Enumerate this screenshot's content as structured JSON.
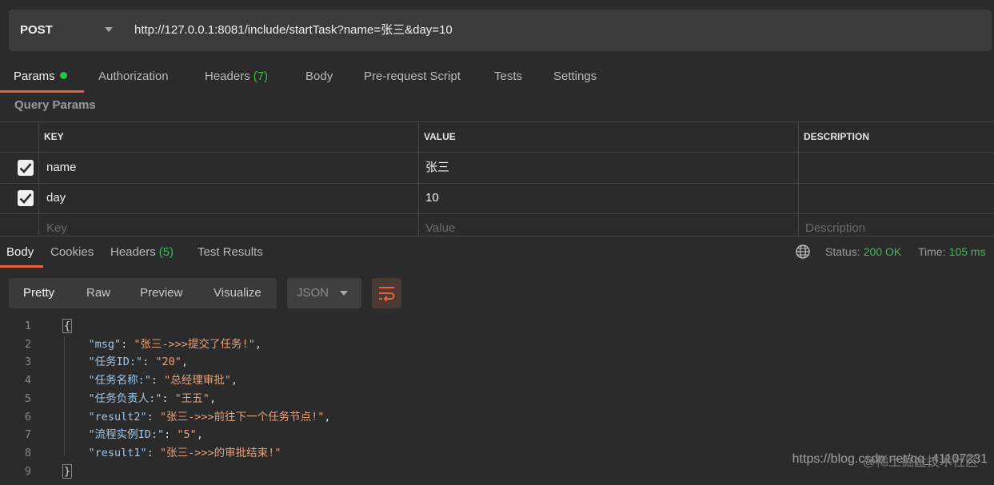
{
  "request": {
    "method": "POST",
    "url": "http://127.0.0.1:8081/include/startTask?name=张三&day=10"
  },
  "request_tabs": [
    {
      "label": "Params",
      "active": true,
      "dot": true
    },
    {
      "label": "Authorization"
    },
    {
      "label": "Headers",
      "count": "(7)"
    },
    {
      "label": "Body"
    },
    {
      "label": "Pre-request Script"
    },
    {
      "label": "Tests"
    },
    {
      "label": "Settings"
    }
  ],
  "params": {
    "section_label": "Query Params",
    "columns": [
      "KEY",
      "VALUE",
      "DESCRIPTION"
    ],
    "rows": [
      {
        "checked": true,
        "key": "name",
        "value": "张三",
        "description": ""
      },
      {
        "checked": true,
        "key": "day",
        "value": "10",
        "description": ""
      }
    ],
    "placeholder": {
      "key": "Key",
      "value": "Value",
      "description": "Description"
    }
  },
  "response_tabs": [
    {
      "label": "Body",
      "active": true
    },
    {
      "label": "Cookies"
    },
    {
      "label": "Headers",
      "count": "(5)"
    },
    {
      "label": "Test Results"
    }
  ],
  "status": {
    "status_label": "Status:",
    "status_value": "200 OK",
    "time_label": "Time:",
    "time_value": "105 ms"
  },
  "view_modes": [
    "Pretty",
    "Raw",
    "Preview",
    "Visualize"
  ],
  "format": "JSON",
  "code_lines": [
    {
      "n": "1",
      "parts": [
        {
          "t": "{",
          "c": "brace"
        }
      ]
    },
    {
      "n": "2",
      "parts": [
        {
          "t": "    ",
          "c": "punct"
        },
        {
          "t": "\"msg\"",
          "c": "key"
        },
        {
          "t": ": ",
          "c": "punct"
        },
        {
          "t": "\"张三->>>提交了任务!\"",
          "c": "str"
        },
        {
          "t": ",",
          "c": "punct"
        }
      ]
    },
    {
      "n": "3",
      "parts": [
        {
          "t": "    ",
          "c": "punct"
        },
        {
          "t": "\"任务ID:\"",
          "c": "key"
        },
        {
          "t": ": ",
          "c": "punct"
        },
        {
          "t": "\"20\"",
          "c": "str"
        },
        {
          "t": ",",
          "c": "punct"
        }
      ]
    },
    {
      "n": "4",
      "parts": [
        {
          "t": "    ",
          "c": "punct"
        },
        {
          "t": "\"任务名称:\"",
          "c": "key"
        },
        {
          "t": ": ",
          "c": "punct"
        },
        {
          "t": "\"总经理审批\"",
          "c": "str"
        },
        {
          "t": ",",
          "c": "punct"
        }
      ]
    },
    {
      "n": "5",
      "parts": [
        {
          "t": "    ",
          "c": "punct"
        },
        {
          "t": "\"任务负责人:\"",
          "c": "key"
        },
        {
          "t": ": ",
          "c": "punct"
        },
        {
          "t": "\"王五\"",
          "c": "str"
        },
        {
          "t": ",",
          "c": "punct"
        }
      ]
    },
    {
      "n": "6",
      "parts": [
        {
          "t": "    ",
          "c": "punct"
        },
        {
          "t": "\"result2\"",
          "c": "key"
        },
        {
          "t": ": ",
          "c": "punct"
        },
        {
          "t": "\"张三->>>前往下一个任务节点!\"",
          "c": "str"
        },
        {
          "t": ",",
          "c": "punct"
        }
      ]
    },
    {
      "n": "7",
      "parts": [
        {
          "t": "    ",
          "c": "punct"
        },
        {
          "t": "\"流程实例ID:\"",
          "c": "key"
        },
        {
          "t": ": ",
          "c": "punct"
        },
        {
          "t": "\"5\"",
          "c": "str"
        },
        {
          "t": ",",
          "c": "punct"
        }
      ]
    },
    {
      "n": "8",
      "parts": [
        {
          "t": "    ",
          "c": "punct"
        },
        {
          "t": "\"result1\"",
          "c": "key"
        },
        {
          "t": ": ",
          "c": "punct"
        },
        {
          "t": "\"张三->>>的审批结束!\"",
          "c": "str"
        }
      ]
    },
    {
      "n": "9",
      "parts": [
        {
          "t": "}",
          "c": "brace"
        }
      ]
    }
  ],
  "watermark": "https://blog.csdn.net/qq_41107231",
  "watermark_overlay": "@稀土掘金技术社区",
  "colors": {
    "accent": "#e8613a",
    "success": "#3fb950",
    "background": "#2b2b2b"
  },
  "icons": [
    "chevron-down-icon",
    "checkbox-checked-icon",
    "globe-icon",
    "wrap-lines-icon"
  ]
}
